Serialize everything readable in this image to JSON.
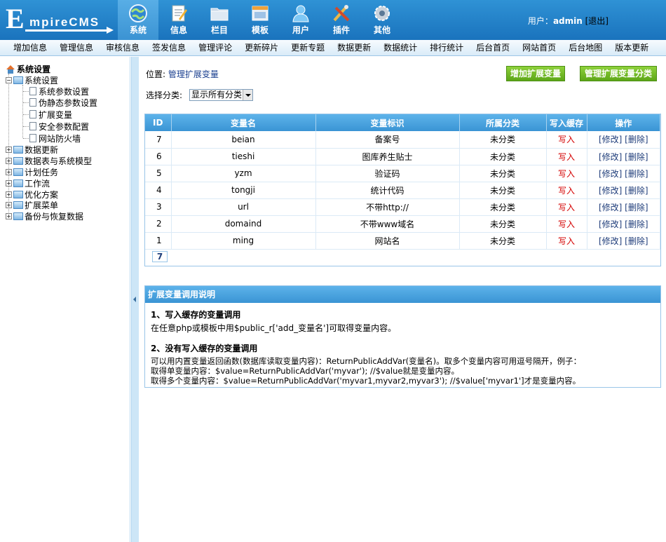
{
  "header": {
    "logo_text": "EmpireCMS",
    "logo_first": "E",
    "logo_rest": "mpireCMS",
    "nav": [
      {
        "label": "系统",
        "icon": "globe-icon",
        "active": true
      },
      {
        "label": "信息",
        "icon": "document-edit-icon",
        "active": false
      },
      {
        "label": "栏目",
        "icon": "folder-icon",
        "active": false
      },
      {
        "label": "模板",
        "icon": "template-window-icon",
        "active": false
      },
      {
        "label": "用户",
        "icon": "user-icon",
        "active": false
      },
      {
        "label": "插件",
        "icon": "tools-icon",
        "active": false
      },
      {
        "label": "其他",
        "icon": "gear-icon",
        "active": false
      }
    ],
    "user_label": "用户：",
    "username": "admin",
    "logout": "[退出]"
  },
  "subnav": [
    "增加信息",
    "管理信息",
    "审核信息",
    "签发信息",
    "管理评论",
    "更新碎片",
    "更新专题",
    "数据更新",
    "数据统计",
    "排行统计",
    "后台首页",
    "网站首页",
    "后台地图",
    "版本更新"
  ],
  "sidebar": {
    "root": "系统设置",
    "open_group": "系统设置",
    "children": [
      "系统参数设置",
      "伪静态参数设置",
      "扩展变量",
      "安全参数配置",
      "网站防火墙"
    ],
    "groups": [
      "数据更新",
      "数据表与系统模型",
      "计划任务",
      "工作流",
      "优化方案",
      "扩展菜单",
      "备份与恢复数据"
    ]
  },
  "main": {
    "location_prefix": "位置:",
    "location_link": "管理扩展变量",
    "btn_add": "增加扩展变量",
    "btn_manage": "管理扩展变量分类",
    "filter_label": "选择分类:",
    "filter_value": "显示所有分类",
    "table": {
      "headers": [
        "ID",
        "变量名",
        "变量标识",
        "所属分类",
        "写入缓存",
        "操作"
      ],
      "rows": [
        {
          "id": "7",
          "name": "beian",
          "label": "备案号",
          "category": "未分类",
          "cache": "写入",
          "edit": "[修改]",
          "del": "[删除]"
        },
        {
          "id": "6",
          "name": "tieshi",
          "label": "图库养生贴士",
          "category": "未分类",
          "cache": "写入",
          "edit": "[修改]",
          "del": "[删除]"
        },
        {
          "id": "5",
          "name": "yzm",
          "label": "验证码",
          "category": "未分类",
          "cache": "写入",
          "edit": "[修改]",
          "del": "[删除]"
        },
        {
          "id": "4",
          "name": "tongji",
          "label": "统计代码",
          "category": "未分类",
          "cache": "写入",
          "edit": "[修改]",
          "del": "[删除]"
        },
        {
          "id": "3",
          "name": "url",
          "label": "不带http://",
          "category": "未分类",
          "cache": "写入",
          "edit": "[修改]",
          "del": "[删除]"
        },
        {
          "id": "2",
          "name": "domaind",
          "label": "不带www域名",
          "category": "未分类",
          "cache": "写入",
          "edit": "[修改]",
          "del": "[删除]"
        },
        {
          "id": "1",
          "name": "ming",
          "label": "网站名",
          "category": "未分类",
          "cache": "写入",
          "edit": "[修改]",
          "del": "[删除]"
        }
      ]
    },
    "pager": "7",
    "help": {
      "title": "扩展变量调用说明",
      "h1": "1、写入缓存的变量调用",
      "p1": "在任意php或模板中用$public_r['add_变量名']可取得变量内容。",
      "h2": "2、没有写入缓存的变量调用",
      "p2_line1": "可以用内置变量返回函数(数据库读取变量内容)：ReturnPublicAddVar(变量名)。取多个变量内容可用逗号隔开，例子：",
      "p2_line2": "取得单变量内容：$value=ReturnPublicAddVar('myvar'); //$value就是变量内容。",
      "p2_line3": "取得多个变量内容：$value=ReturnPublicAddVar('myvar1,myvar2,myvar3'); //$value['myvar1']才是变量内容。"
    }
  },
  "colors": {
    "header_blue": "#1a73bd",
    "table_head_blue": "#3a94d4",
    "button_green": "#5da618",
    "write_red": "#d40000",
    "link_blue": "#1f3d7a"
  }
}
